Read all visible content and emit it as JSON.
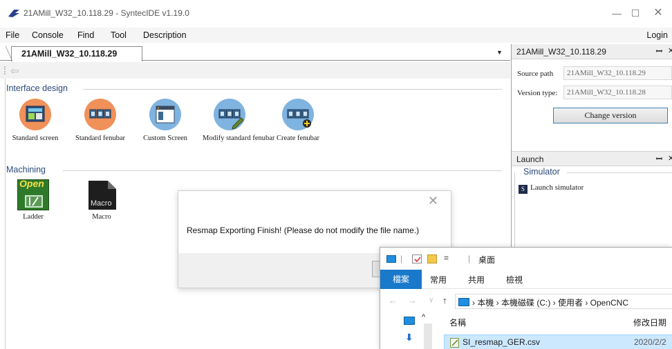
{
  "window": {
    "title": "21AMill_W32_10.118.29 - SyntecIDE v1.19.0",
    "minimize": "—",
    "maximize": "☐",
    "close": "✕"
  },
  "menu": {
    "items": [
      "File",
      "Console",
      "Find",
      "Tool",
      "Description"
    ],
    "login": "Login"
  },
  "document": {
    "tab_label": "21AMill_W32_10.118.29",
    "dropdown": "▼",
    "back": "⇦"
  },
  "interface_design": {
    "title": "Interface design",
    "tools": [
      {
        "label": "Standard screen",
        "icon": "standard-screen-icon"
      },
      {
        "label": "Standard fenubar",
        "icon": "standard-fenubar-icon"
      },
      {
        "label": "Custom Screen",
        "icon": "custom-screen-icon"
      },
      {
        "label": "Modify standard fenubar",
        "icon": "modify-fenubar-icon"
      },
      {
        "label": "Create fenubar",
        "icon": "create-fenubar-icon"
      }
    ]
  },
  "machining": {
    "title": "Machining",
    "tools": [
      {
        "label": "Ladder",
        "icon_text": "Open",
        "icon": "ladder-icon"
      },
      {
        "label": "Macro",
        "icon_text": "Macro",
        "icon": "macro-icon"
      }
    ]
  },
  "dialog": {
    "message": "Resmap Exporting Finish! (Please do not modify the file name.)",
    "close": "✕"
  },
  "project_panel": {
    "title": "21AMill_W32_10.118.29",
    "pin": "ꟷ",
    "close": "✕",
    "source_path_label": "Source path",
    "source_path_value": "21AMill_W32_10.118.29",
    "version_type_label": "Version type:",
    "version_type_value": "21AMill_W32_10.118.28",
    "change_version": "Change version"
  },
  "launch_panel": {
    "title": "Launch",
    "pin": "ꟷ",
    "close": "✕",
    "simulator_title": "Simulator",
    "launch_simulator": "Launch simulator"
  },
  "explorer": {
    "title": "桌面",
    "qat_separator": "|",
    "qat_caret": "=",
    "tabs": {
      "file": "檔案",
      "home": "常用",
      "share": "共用",
      "view": "檢視"
    },
    "nav": {
      "back": "←",
      "forward": "→",
      "recent": "∨",
      "up": "↑"
    },
    "address": "›  本機  ›  本機磁碟 (C:)  ›  使用者  ›  OpenCNC",
    "columns": {
      "name": "名稱",
      "date": "修改日期"
    },
    "file": {
      "name": "SI_resmap_GER.csv",
      "date": "2020/2/2"
    }
  },
  "colors": {
    "accent": "#1979ca",
    "group_title": "#2d4a7a",
    "selected_row": "#cce8ff"
  }
}
